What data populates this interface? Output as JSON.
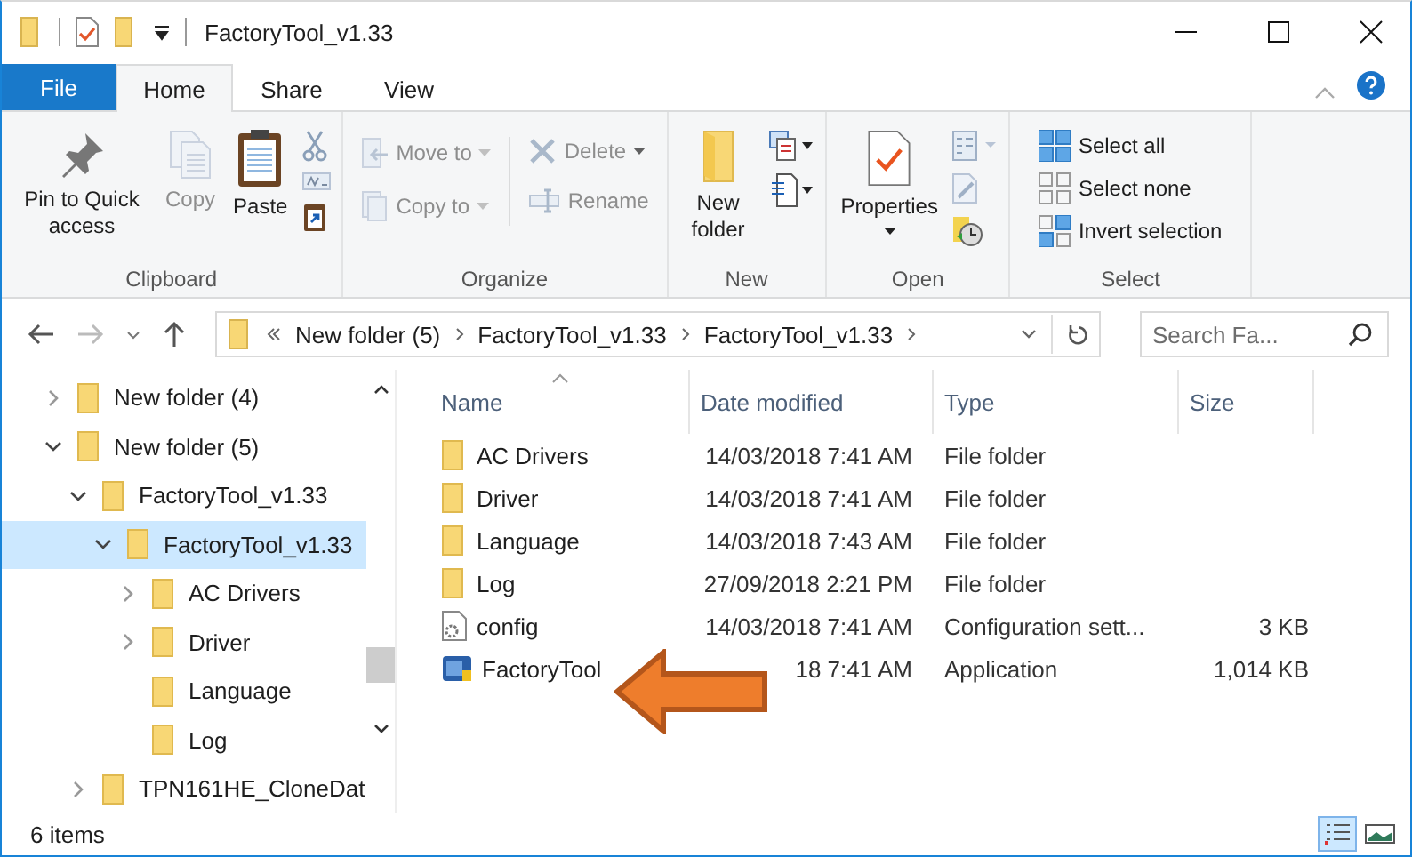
{
  "window": {
    "title": "FactoryTool_v1.33"
  },
  "tabs": [
    {
      "label": "File",
      "kind": "file",
      "selected": false
    },
    {
      "label": "Home",
      "kind": "tab",
      "selected": true
    },
    {
      "label": "Share",
      "kind": "tab",
      "selected": false
    },
    {
      "label": "View",
      "kind": "tab",
      "selected": false
    }
  ],
  "ribbon": {
    "clipboard": {
      "label": "Clipboard",
      "pin": {
        "label": "Pin to Quick access",
        "disabled": false
      },
      "copy": {
        "label": "Copy",
        "disabled": true
      },
      "paste": {
        "label": "Paste",
        "disabled": false
      }
    },
    "organize": {
      "label": "Organize",
      "move_to": {
        "label": "Move to",
        "disabled": true
      },
      "copy_to": {
        "label": "Copy to",
        "disabled": true
      },
      "delete": {
        "label": "Delete",
        "disabled": true
      },
      "rename": {
        "label": "Rename",
        "disabled": true
      }
    },
    "new": {
      "label": "New",
      "new_folder": {
        "label": "New folder"
      }
    },
    "open": {
      "label": "Open",
      "properties": {
        "label": "Properties"
      }
    },
    "select": {
      "label": "Select",
      "items": [
        {
          "label": "Select all"
        },
        {
          "label": "Select none"
        },
        {
          "label": "Invert selection"
        }
      ]
    }
  },
  "address": {
    "path": [
      "New folder (5)",
      "FactoryTool_v1.33",
      "FactoryTool_v1.33"
    ]
  },
  "search": {
    "placeholder": "Search Fa..."
  },
  "tree": [
    {
      "label": "New folder (4)",
      "expanded": false,
      "selected": false
    },
    {
      "label": "New folder (5)",
      "expanded": true,
      "selected": false,
      "children": [
        {
          "label": "FactoryTool_v1.33",
          "expanded": true,
          "selected": false,
          "children": [
            {
              "label": "FactoryTool_v1.33",
              "expanded": true,
              "selected": true,
              "children": [
                {
                  "label": "AC Drivers",
                  "expanded": false,
                  "selected": false
                },
                {
                  "label": "Driver",
                  "expanded": false,
                  "selected": false
                },
                {
                  "label": "Language",
                  "selected": false
                },
                {
                  "label": "Log",
                  "selected": false
                }
              ]
            }
          ]
        },
        {
          "label": "TPN161HE_CloneDat",
          "expanded": false,
          "selected": false
        }
      ]
    }
  ],
  "files": {
    "columns": [
      "Name",
      "Date modified",
      "Type",
      "Size"
    ],
    "rows": [
      {
        "name": "AC Drivers",
        "kind": "folder",
        "date": "14/03/2018 7:41 AM",
        "type": "File folder",
        "size": ""
      },
      {
        "name": "Driver",
        "kind": "folder",
        "date": "14/03/2018 7:41 AM",
        "type": "File folder",
        "size": ""
      },
      {
        "name": "Language",
        "kind": "folder",
        "date": "14/03/2018 7:43 AM",
        "type": "File folder",
        "size": ""
      },
      {
        "name": "Log",
        "kind": "folder",
        "date": "27/09/2018 2:21 PM",
        "type": "File folder",
        "size": ""
      },
      {
        "name": "config",
        "kind": "config",
        "date": "14/03/2018 7:41 AM",
        "type": "Configuration sett...",
        "size": "3 KB"
      },
      {
        "name": "FactoryTool",
        "kind": "app",
        "date": "18 7:41 AM",
        "type": "Application",
        "size": "1,014 KB"
      }
    ]
  },
  "annotation": {
    "kind": "arrow"
  },
  "status_bar": {
    "count": "6 items",
    "views": [
      {
        "kind": "details",
        "selected": true
      },
      {
        "kind": "large",
        "selected": false
      }
    ]
  }
}
